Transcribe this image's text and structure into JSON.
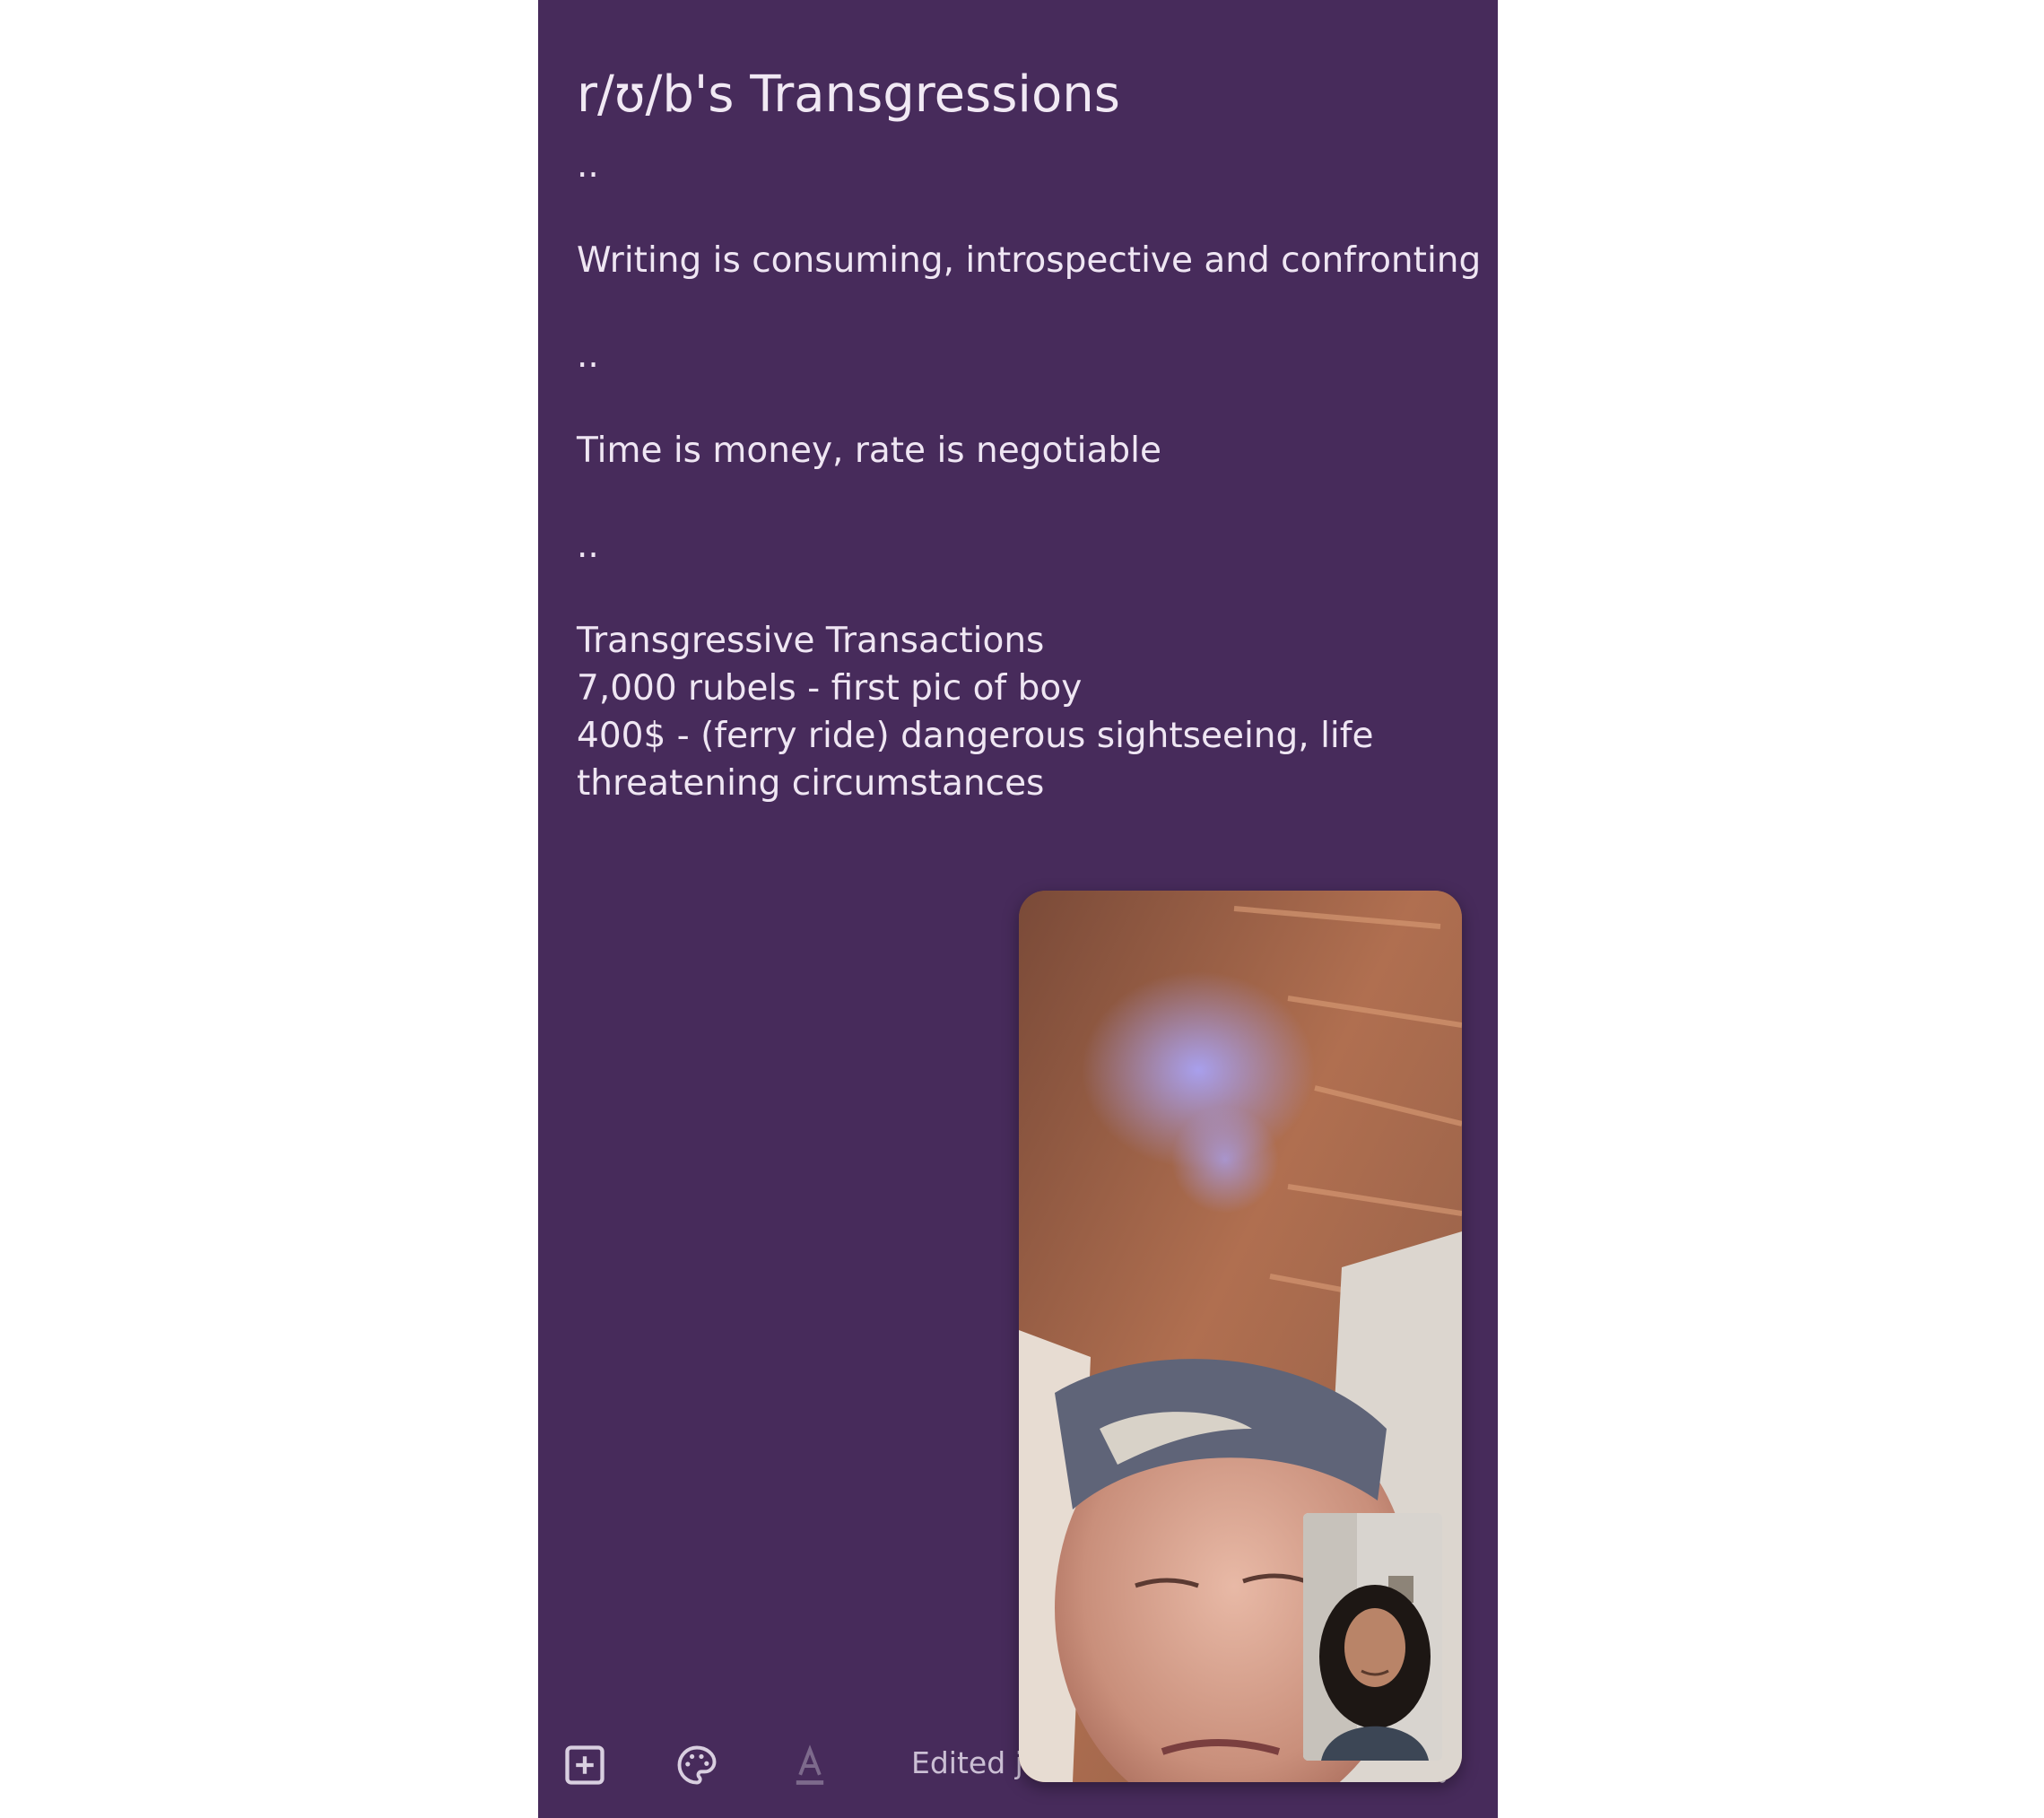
{
  "note": {
    "title": "r/ʊ/b's Transgressions",
    "lines": [
      "..",
      "",
      "Writing is consuming, introspective and confronting",
      "",
      "..",
      "",
      "Time is money, rate is negotiable",
      "",
      "..",
      "",
      "Transgressive Transactions",
      "7,000 rubels - first pic of boy",
      "400$ - (ferry ride) dangerous sightseeing, life",
      "threatening circumstances"
    ]
  },
  "toolbar": {
    "add_icon": "add-box-icon",
    "palette_icon": "palette-icon",
    "text_format_icon": "text-format-icon",
    "edited_label": "Edited ju",
    "more_icon": "more-vert-icon"
  },
  "video_call": {
    "remote_feed": "remote-video-feed",
    "self_view": "self-view-feed"
  },
  "colors": {
    "note_background": "#472b5b",
    "text": "#efe6f3",
    "page_background": "#ffffff"
  }
}
